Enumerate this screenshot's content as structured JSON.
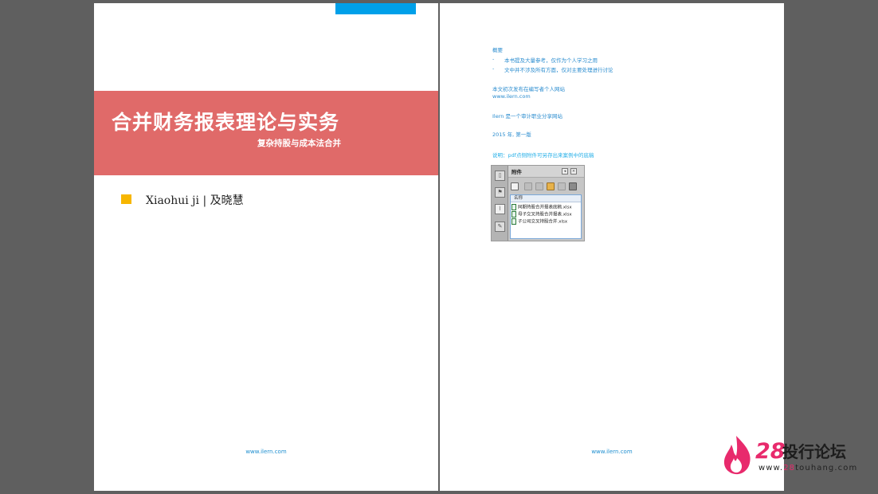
{
  "left_page": {
    "title": "合并财务报表理论与实务",
    "subtitle": "复杂持股与成本法合并",
    "author": "Xiaohui ji |  及晓慧",
    "footer_url": "www.ilern.com",
    "colors": {
      "accent_top": "#00a0e9",
      "title_band": "#e06a69",
      "author_square": "#f7b600"
    }
  },
  "right_page": {
    "summary_heading": "概要",
    "bullets": [
      "本书提及大量参考，仅作为个人学习之用",
      "文中并不涉及所有方面，仅对主要处理进行讨论"
    ],
    "first_publish": "本文初次发布在编写者个人网站",
    "site_url": "www.ilern.com",
    "ilern_desc": "Ilern 是一个审计职业分享网站",
    "edition": "2015 年, 第一版",
    "note": "说明：pdf点侧附件可另存出来案例中的底稿",
    "footer_url": "www.ilern.com",
    "attachments": {
      "title": "附件",
      "column_header": "名称",
      "files": [
        "同期持股合并报表底稿.xlsx",
        "母子交叉持股合并报表.xlsx",
        "子公司交叉持股合并.xlsx"
      ]
    }
  },
  "watermark": {
    "number": "28",
    "name": "投行论坛",
    "url_prefix": "www.",
    "url_highlight": "28",
    "url_suffix": "touhang.com",
    "color": "#e82a6c"
  }
}
